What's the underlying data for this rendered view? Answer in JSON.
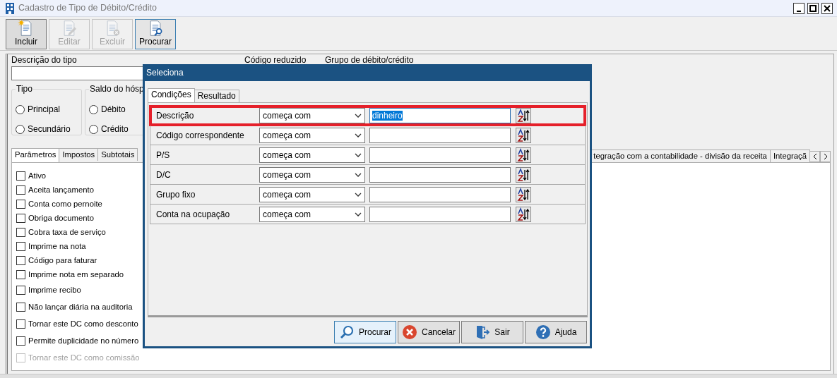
{
  "window": {
    "title": "Cadastro de Tipo de Débito/Crédito"
  },
  "toolbar": [
    {
      "label": "Incluir",
      "kind": "new",
      "disabled": false,
      "selected": false
    },
    {
      "label": "Editar",
      "kind": "edit",
      "disabled": true,
      "selected": false
    },
    {
      "label": "Excluir",
      "kind": "delete",
      "disabled": true,
      "selected": false
    },
    {
      "label": "Procurar",
      "kind": "search",
      "disabled": false,
      "selected": true
    }
  ],
  "form": {
    "description_label": "Descrição do tipo",
    "code_label": "Código reduzido",
    "group_label": "Grupo de débito/crédito",
    "groups": [
      {
        "legend": "Tipo",
        "options": [
          {
            "label": "Principal",
            "selected": false
          },
          {
            "label": "Secundário",
            "selected": false
          }
        ]
      },
      {
        "legend": "Saldo do hósp",
        "options": [
          {
            "label": "Débito",
            "selected": false
          },
          {
            "label": "Crédito",
            "selected": false
          }
        ]
      }
    ]
  },
  "tabs_left": [
    {
      "label": "Parâmetros",
      "selected": true
    },
    {
      "label": "Impostos",
      "selected": false
    },
    {
      "label": "Subtotais",
      "selected": false
    }
  ],
  "tabs_right": [
    {
      "label": "tegração com a contabilidade - divisão da receita",
      "selected": false
    },
    {
      "label": "Integraçã",
      "selected": false
    }
  ],
  "checkboxes": [
    {
      "label": "Ativo",
      "checked": false,
      "disabled": false
    },
    {
      "label": "Aceita lançamento",
      "checked": false,
      "disabled": false
    },
    {
      "label": "Conta como pernoite",
      "checked": false,
      "disabled": false
    },
    {
      "label": "Obriga documento",
      "checked": false,
      "disabled": false
    },
    {
      "label": "Cobra taxa de serviço",
      "checked": false,
      "disabled": false
    },
    {
      "label": "Imprime na nota",
      "checked": false,
      "disabled": false
    },
    {
      "label": "Código para faturar",
      "checked": false,
      "disabled": false
    },
    {
      "label": "Imprime nota em separado",
      "checked": false,
      "disabled": false
    },
    {
      "label": "Imprime recibo",
      "checked": false,
      "disabled": false
    },
    {
      "label": "Não lançar diária na auditoria",
      "checked": false,
      "disabled": false
    },
    {
      "label": "Tornar este DC como desconto",
      "checked": false,
      "disabled": false
    },
    {
      "label": "Permite duplicidade no número",
      "checked": false,
      "disabled": false
    },
    {
      "label": "Tornar este DC como comissão",
      "checked": false,
      "disabled": true
    }
  ],
  "dialog": {
    "title": "Seleciona",
    "tabs": [
      {
        "label": "Condições",
        "selected": true
      },
      {
        "label": "Resultado",
        "selected": false
      }
    ],
    "conditions": [
      {
        "field": "Descrição",
        "operator": "começa com",
        "value": "dinheiro",
        "highlighted": true,
        "text_selected": true
      },
      {
        "field": "Código correspondente",
        "operator": "começa com",
        "highlighted": false
      },
      {
        "field": "P/S",
        "operator": "começa com",
        "highlighted": false
      },
      {
        "field": "D/C",
        "operator": "começa com",
        "highlighted": false
      },
      {
        "field": "Grupo fixo",
        "operator": "começa com",
        "highlighted": false
      },
      {
        "field": "Conta na ocupação",
        "operator": "começa com",
        "highlighted": false
      }
    ],
    "buttons": [
      {
        "label": "Procurar",
        "kind": "search",
        "focused": true
      },
      {
        "label": "Cancelar",
        "kind": "cancel",
        "focused": false
      },
      {
        "label": "Sair",
        "kind": "exit",
        "focused": false
      },
      {
        "label": "Ajuda",
        "kind": "help",
        "focused": false
      }
    ]
  }
}
